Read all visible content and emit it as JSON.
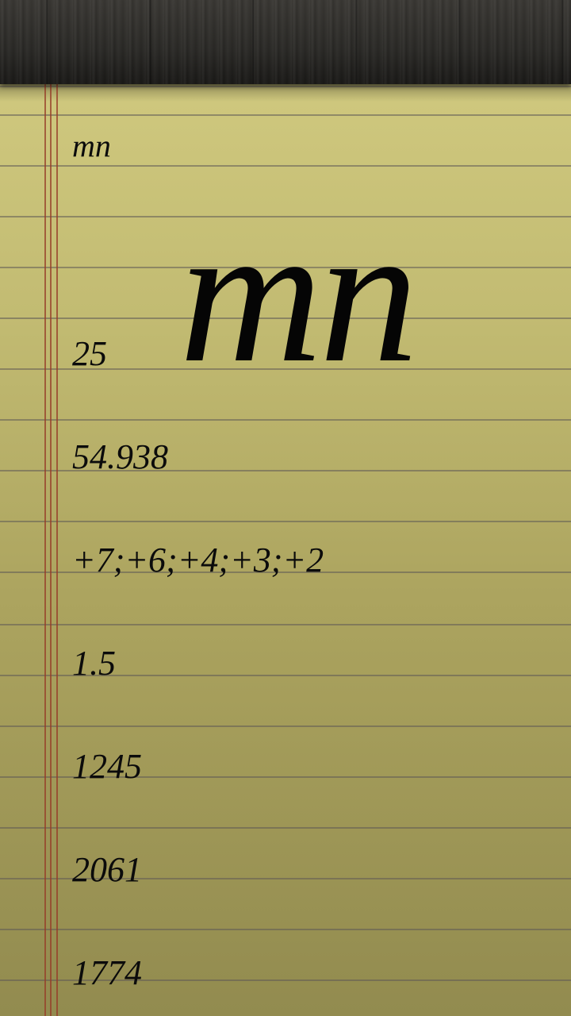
{
  "note": {
    "symbol_small": "mn",
    "symbol_large": "mn",
    "lines": [
      "25",
      "54.938",
      "+7;+6;+4;+3;+2",
      "1.5",
      "1245",
      "2061",
      "1774"
    ]
  }
}
